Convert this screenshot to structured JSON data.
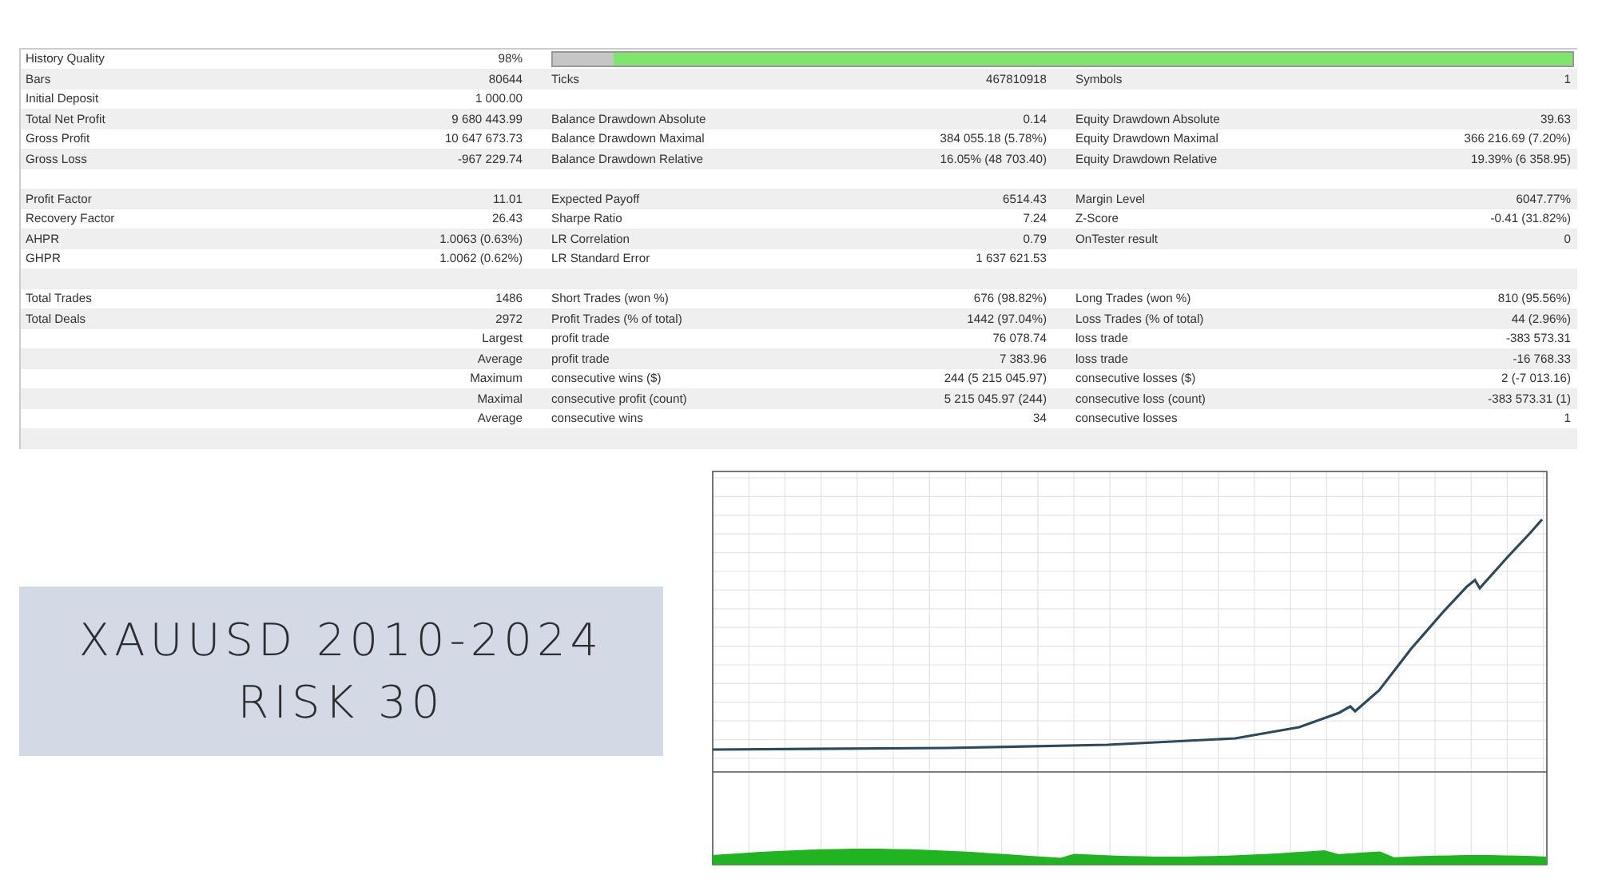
{
  "report": {
    "rows": [
      {
        "kind": "quality",
        "label": "History Quality",
        "value": "98%",
        "level": 0.94
      },
      {
        "kind": "data",
        "cells": [
          {
            "label": "Bars",
            "value": "80644"
          },
          {
            "label": "Ticks",
            "value": "467810918"
          },
          {
            "label": "Symbols",
            "value": "1"
          }
        ]
      },
      {
        "kind": "data",
        "cells": [
          {
            "label": "Initial Deposit",
            "value": "1 000.00"
          }
        ]
      },
      {
        "kind": "data",
        "cells": [
          {
            "label": "Total Net Profit",
            "value": "9 680 443.99"
          },
          {
            "label": "Balance Drawdown Absolute",
            "value": "0.14"
          },
          {
            "label": "Equity Drawdown Absolute",
            "value": "39.63"
          }
        ]
      },
      {
        "kind": "data",
        "cells": [
          {
            "label": "Gross Profit",
            "value": "10 647 673.73"
          },
          {
            "label": "Balance Drawdown Maximal",
            "value": "384 055.18 (5.78%)"
          },
          {
            "label": "Equity Drawdown Maximal",
            "value": "366 216.69 (7.20%)"
          }
        ]
      },
      {
        "kind": "data",
        "cells": [
          {
            "label": "Gross Loss",
            "value": "-967 229.74"
          },
          {
            "label": "Balance Drawdown Relative",
            "value": "16.05% (48 703.40)"
          },
          {
            "label": "Equity Drawdown Relative",
            "value": "19.39% (6 358.95)"
          }
        ]
      },
      {
        "kind": "blank"
      },
      {
        "kind": "data",
        "cells": [
          {
            "label": "Profit Factor",
            "value": "11.01"
          },
          {
            "label": "Expected Payoff",
            "value": "6514.43"
          },
          {
            "label": "Margin Level",
            "value": "6047.77%"
          }
        ]
      },
      {
        "kind": "data",
        "cells": [
          {
            "label": "Recovery Factor",
            "value": "26.43"
          },
          {
            "label": "Sharpe Ratio",
            "value": "7.24"
          },
          {
            "label": "Z-Score",
            "value": "-0.41 (31.82%)"
          }
        ]
      },
      {
        "kind": "data",
        "cells": [
          {
            "label": "AHPR",
            "value": "1.0063 (0.63%)"
          },
          {
            "label": "LR Correlation",
            "value": "0.79"
          },
          {
            "label": "OnTester result",
            "value": "0"
          }
        ]
      },
      {
        "kind": "data",
        "cells": [
          {
            "label": "GHPR",
            "value": "1.0062 (0.62%)"
          },
          {
            "label": "LR Standard Error",
            "value": "1 637 621.53"
          }
        ]
      },
      {
        "kind": "blank"
      },
      {
        "kind": "data",
        "cells": [
          {
            "label": "Total Trades",
            "value": "1486"
          },
          {
            "label": "Short Trades (won %)",
            "value": "676 (98.82%)"
          },
          {
            "label": "Long Trades (won %)",
            "value": "810 (95.56%)"
          }
        ]
      },
      {
        "kind": "data",
        "cells": [
          {
            "label": "Total Deals",
            "value": "2972"
          },
          {
            "label": "Profit Trades (% of total)",
            "value": "1442 (97.04%)"
          },
          {
            "label": "Loss Trades (% of total)",
            "value": "44 (2.96%)"
          }
        ]
      },
      {
        "kind": "data",
        "cells": [
          {
            "value": "Largest"
          },
          {
            "label": "profit trade",
            "value": "76 078.74"
          },
          {
            "label": "loss trade",
            "value": "-383 573.31"
          }
        ]
      },
      {
        "kind": "data",
        "cells": [
          {
            "value": "Average"
          },
          {
            "label": "profit trade",
            "value": "7 383.96"
          },
          {
            "label": "loss trade",
            "value": "-16 768.33"
          }
        ]
      },
      {
        "kind": "data",
        "cells": [
          {
            "value": "Maximum"
          },
          {
            "label": "consecutive wins ($)",
            "value": "244 (5 215 045.97)"
          },
          {
            "label": "consecutive losses ($)",
            "value": "2 (-7 013.16)"
          }
        ]
      },
      {
        "kind": "data",
        "cells": [
          {
            "value": "Maximal"
          },
          {
            "label": "consecutive profit (count)",
            "value": "5 215 045.97 (244)"
          },
          {
            "label": "consecutive loss (count)",
            "value": "-383 573.31 (1)"
          }
        ]
      },
      {
        "kind": "data",
        "cells": [
          {
            "value": "Average"
          },
          {
            "label": "consecutive wins",
            "value": "34"
          },
          {
            "label": "consecutive losses",
            "value": "1"
          }
        ]
      },
      {
        "kind": "blank"
      }
    ]
  },
  "caption": {
    "lines": [
      "XAUUSD 2010-2024",
      "RISK 30"
    ]
  }
}
